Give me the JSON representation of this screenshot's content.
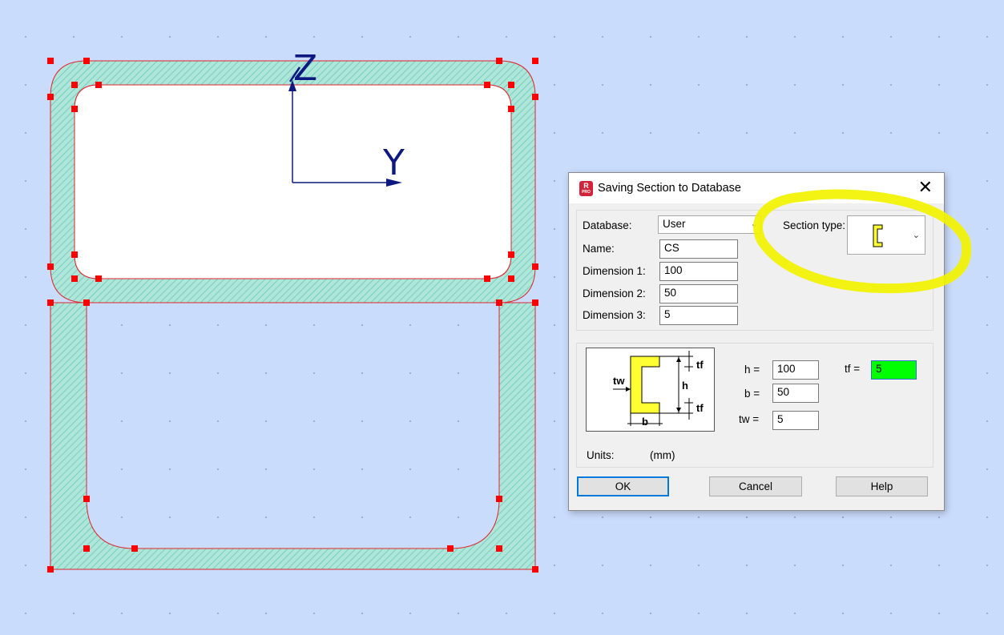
{
  "canvas": {
    "axes": {
      "z_label": "Z",
      "y_label": "Y"
    },
    "colors": {
      "background": "#cadcfc",
      "hatch_fill": "#aee6da",
      "outline": "#e0242c",
      "handles": "#ff0000",
      "axes": "#0d1880"
    }
  },
  "dialog": {
    "title": "Saving Section to Database",
    "app_icon": "robot-app-icon",
    "close_icon": "close-icon",
    "database_label": "Database:",
    "database_value": "User",
    "name_label": "Name:",
    "name_value": "CS",
    "dim1_label": "Dimension 1:",
    "dim1_value": "100",
    "dim2_label": "Dimension 2:",
    "dim2_value": "50",
    "dim3_label": "Dimension 3:",
    "dim3_value": "5",
    "section_type_label": "Section type:",
    "section_type_icon": "channel-section-icon",
    "sketch": {
      "tf": "tf",
      "tw": "tw",
      "h": "h",
      "b": "b"
    },
    "h_label": "h =",
    "h_value": "100",
    "b_label": "b =",
    "b_value": "50",
    "tw_label": "tw =",
    "tw_value": "5",
    "tf_label": "tf =",
    "tf_value": "5",
    "units_label": "Units:",
    "units_value": "(mm)",
    "ok_label": "OK",
    "cancel_label": "Cancel",
    "help_label": "Help",
    "colors": {
      "tf_field": "#00ff00",
      "section_fill": "#ffff33",
      "annotation": "#f2f200"
    }
  }
}
